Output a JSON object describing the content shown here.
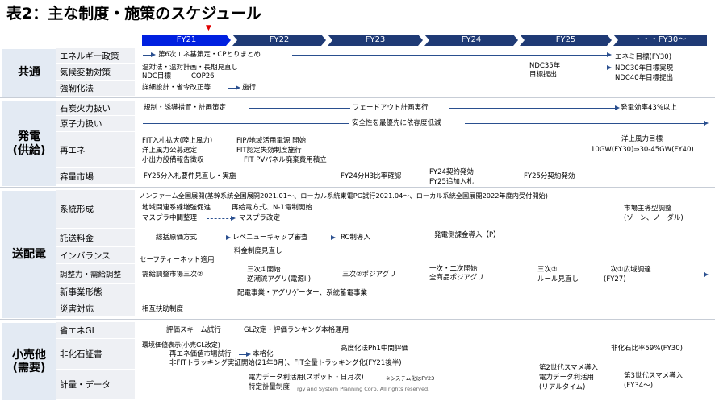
{
  "title": "表2：主な制度・施策のスケジュール",
  "years": [
    "FY21",
    "FY22",
    "FY23",
    "FY24",
    "FY25",
    "・・・FY30～"
  ],
  "marker": "▼",
  "colors": {
    "fy_current": "#0020e0",
    "fy_other": "#1f3a75",
    "category_bg": "#e3eaf3",
    "row_bg": "#eef0f4",
    "arrow": "#2a4f8f"
  },
  "categories": {
    "common": "共通",
    "power": "発電\n(供給)",
    "grid": "送配電",
    "retail": "小売他\n(需要)"
  },
  "rows": {
    "energy_policy": "エネルギー政策",
    "climate": "気候変動対策",
    "resilience": "強靭化法",
    "coal": "石炭火力扱い",
    "nuclear": "原子力扱い",
    "renewable": "再エネ",
    "capacity": "容量市場",
    "grid_formation": "系統形成",
    "wheeling": "託送料金",
    "imbalance": "インバランス",
    "adjust": "調整力・需給調整",
    "new_business": "新事業形態",
    "disaster": "災害対応",
    "energy_saving": "省エネGL",
    "nonfossil": "非化石証書",
    "metering": "計量・データ"
  },
  "texts": {
    "t1": "第6次エネ基策定・CPとりまとめ",
    "t2": "エネミ目標(FY30)",
    "t3": "温対法・温対計画・長期見直し",
    "t4": "NDC35年",
    "t5": "目標提出",
    "t6": "NDC目標",
    "t7": "COP26",
    "t8": "NDC30年目標実現",
    "t9": "NDC40年目標提出",
    "t10": "詳細設計・省令改正等",
    "t11": "施行",
    "t12": "規制・誘導措置・計画策定",
    "t13": "フェードアウト計画実行",
    "t14": "発電効率43%以上",
    "t15": "安全性を最優先に依存度低減",
    "t16": "FIT入札拡大(陸上風力)",
    "t17": "洋上風力公募選定",
    "t18": "小出力設備報告徴収",
    "t19": "FIP/地域活用電源 開始",
    "t20": "FIT認定失効制度施行",
    "t21": "FIT PVパネル廃棄費用積立",
    "t22": "洋上風力目標",
    "t23": "10GW(FY30)⇒30-45GW(FY40)",
    "t24": "FY25分入札要件見直し・実施",
    "t25": "FY24分H3比率確認",
    "t26": "FY24契約発効",
    "t27": "FY25追加入札",
    "t28": "FY25分契約発効",
    "t29": "ノンファーム全国展開(基幹系統全国展開2021.01～、ローカル系統東電PG試行2021.04～、ローカル系統全国展開2022年度内受付開始)",
    "t30": "地域間連系線増強促進",
    "t31": "再給電方式、N-1電制開始",
    "t32": "マスプラ中間整理",
    "t33": "マスプラ改定",
    "t34": "市場主導型調整",
    "t35": "(ゾーン、ノーダル)",
    "t36": "総括原価方式",
    "t37": "レベニューキャップ審査",
    "t38": "RC制導入",
    "t39": "発電側課金導入【P】",
    "t40": "料金制度見直し",
    "t41": "セーフティーネット適用",
    "t42": "需給調整市場三次②",
    "t43": "三次①開始",
    "t44": "逆潮流アグリ(電源Ⅰ')",
    "t45": "三次②ポジアグリ",
    "t46": "一次・二次開始",
    "t47": "全商品ポジアグリ",
    "t48": "三次②",
    "t49": "ルール見直し",
    "t50": "二次①広域調達",
    "t51": "(FY27)",
    "t52": "配電事業・アグリゲーター、系統蓄電事業",
    "t53": "相互扶助制度",
    "t54": "評価スキーム試行",
    "t55": "GL改定・評価ランキング本格運用",
    "t56": "環境価値表示(小売GL改定)",
    "t57": "再エネ価値市場試行",
    "t58": "本格化",
    "t59": "非FITトラッキング実証開始(21年8月)、FIT全量トラッキング化(FY21後半)",
    "t60": "高度化法Ph1中間評価",
    "t61": "非化石比率59%(FY30)",
    "t62": "電力データ利活用(スポット・日月次)",
    "t63": "※システム化はFY23",
    "t64": "特定計量制度",
    "t65": "第2世代スマメ導入",
    "t66": "電力データ利活用",
    "t67": "(リアルタイム)",
    "t68": "第3世代スマメ導入",
    "t69": "(FY34～)",
    "t70": "rgy and System Planning Corp. All rights reserved."
  }
}
